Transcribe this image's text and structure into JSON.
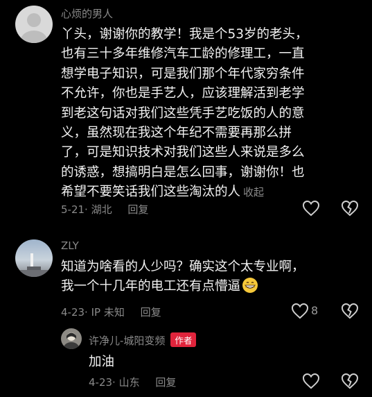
{
  "comments": [
    {
      "username": "心烦的男人",
      "lines": [
        "丫头，谢谢你的教学！我是个53岁的老头，",
        "也有三十多年维修汽车工龄的修理工，一直",
        "想学电子知识，可是我们那个年代家穷条件",
        "不允许，你也是手艺人，应该理解活到老学",
        "到老这句话对我们这些凭手艺吃饭的人的意",
        "义，虽然现在我这个年纪不需要再那么拼",
        "了，可是知识技术对我们这些人来说是多么",
        "的诱惑，想搞明白是怎么回事，谢谢你！也",
        "希望不要笑话我们这些淘汰的人"
      ],
      "collapse_label": "收起",
      "date_location": "5-21· 湖北",
      "reply_label": "回复"
    },
    {
      "username": "ZLY",
      "lines": [
        "知道为啥看的人少吗？确实这个太专业啊，",
        "我一个十几年的电工还有点懵逼"
      ],
      "emoji": "grinning-face",
      "date_location": "4-23· IP 未知",
      "reply_label": "回复",
      "like_count": "8"
    }
  ],
  "reply": {
    "username": "许净儿-城阳变频",
    "author_badge": "作者",
    "text": "加油",
    "date_location": "4-23· 山东",
    "reply_label": "回复"
  },
  "colors": {
    "background": "#000000",
    "badge": "#e0243c",
    "muted": "#8a8a8a"
  }
}
